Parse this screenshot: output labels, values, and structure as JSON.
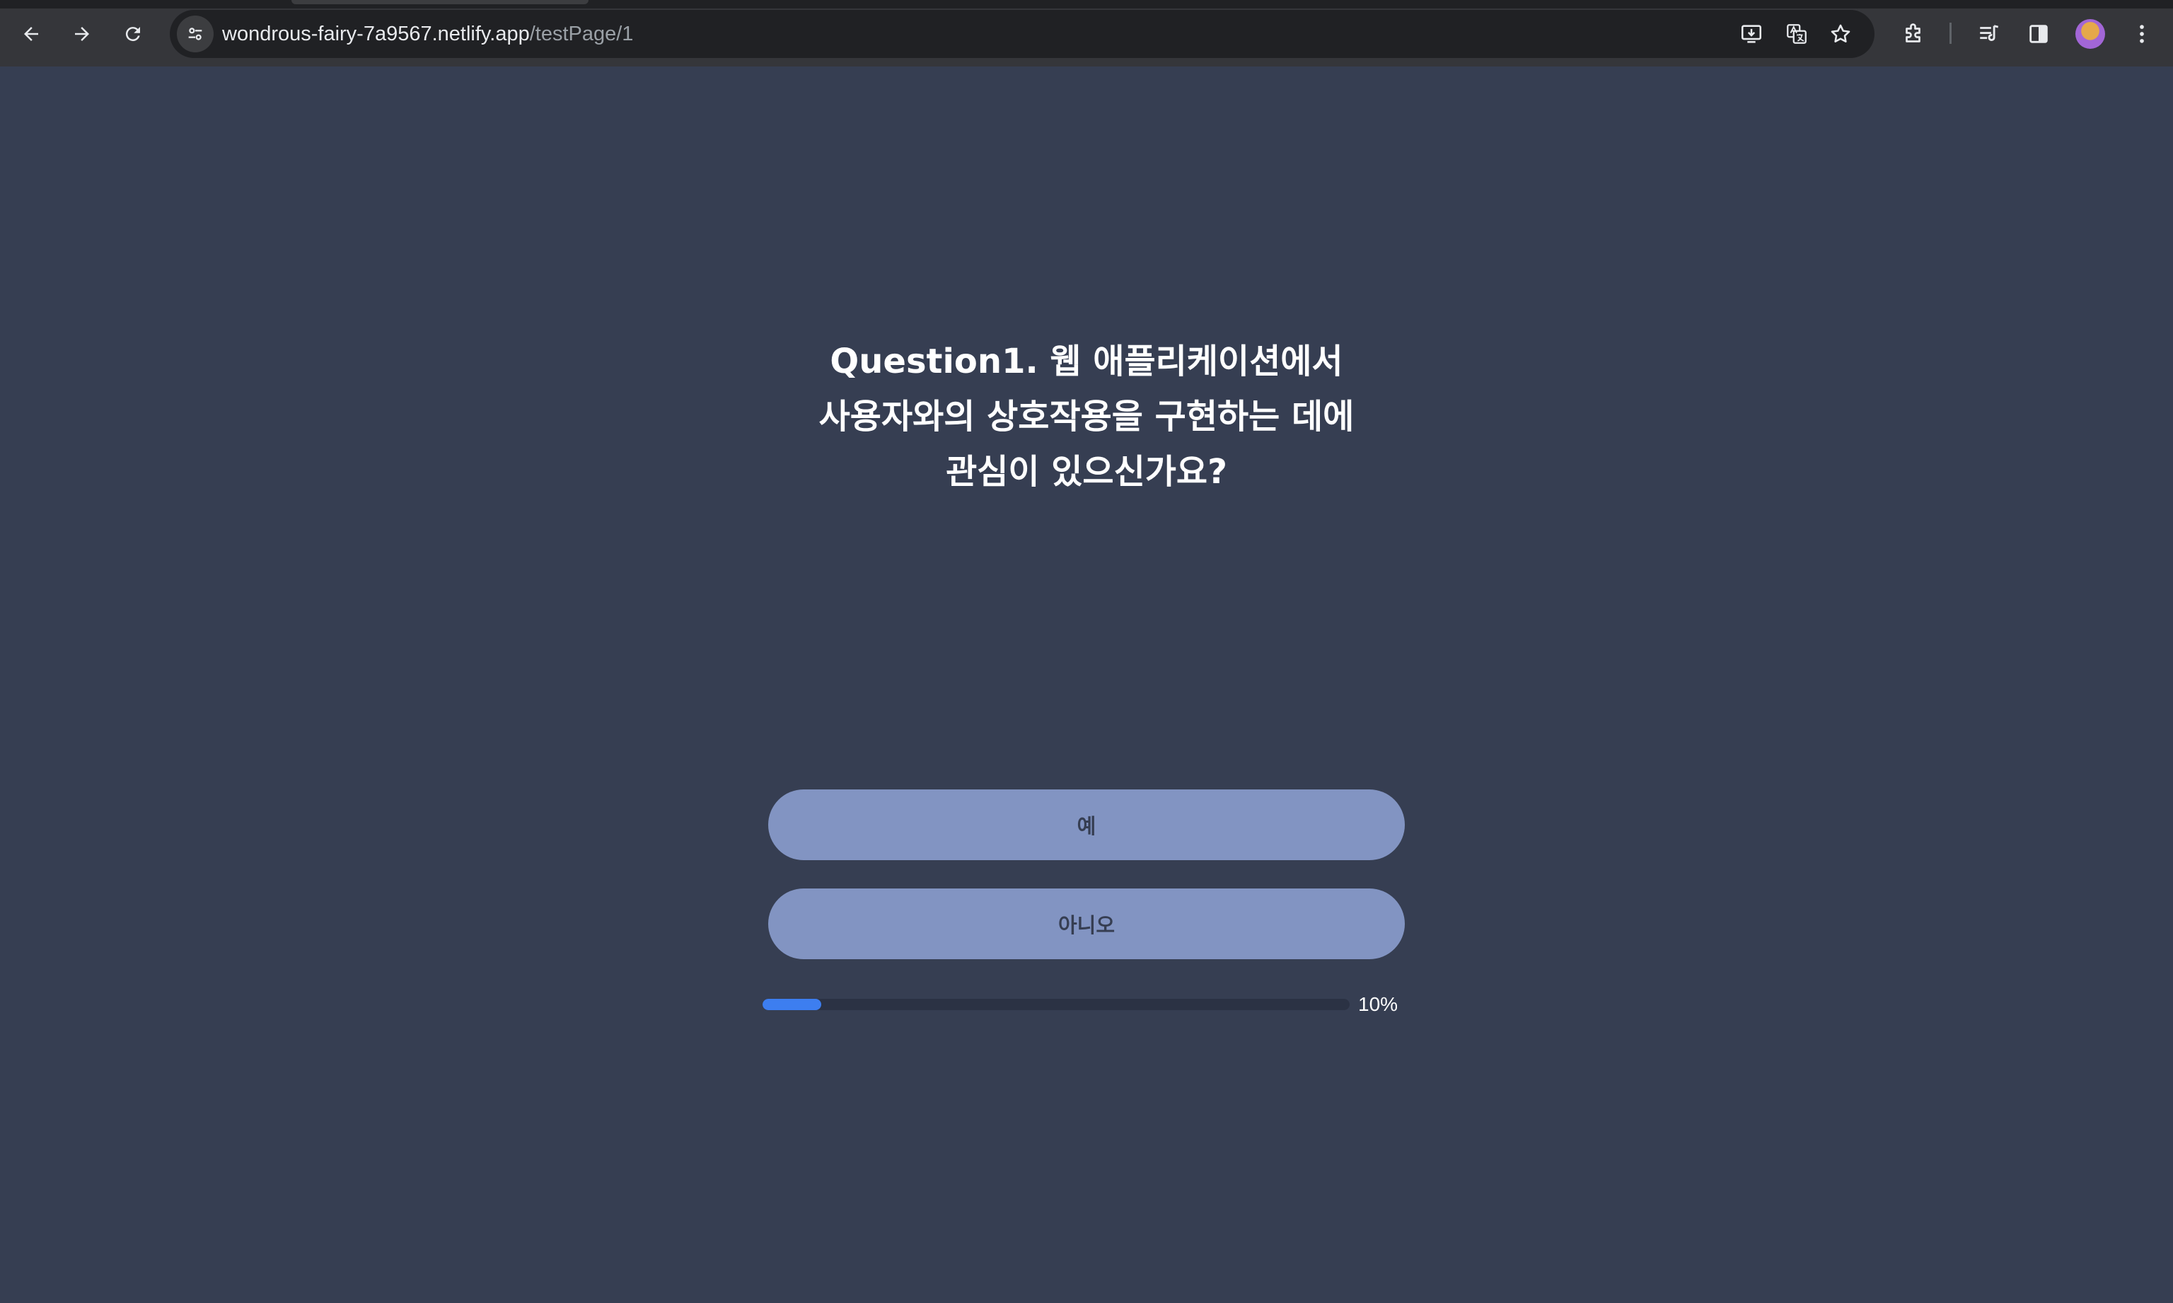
{
  "browser": {
    "url_host": "wondrous-fairy-7a9567.netlify.app",
    "url_path": "/testPage/1",
    "icons": {
      "back": "arrow-left-icon",
      "forward": "arrow-right-icon",
      "reload": "reload-icon",
      "site_info": "tune-icon",
      "install": "install-app-icon",
      "translate": "translate-icon",
      "bookmark": "star-icon",
      "extensions": "puzzle-icon",
      "media": "media-control-icon",
      "side_panel": "side-panel-icon",
      "menu": "more-vertical-icon"
    }
  },
  "quiz": {
    "question": "Question1. 웹 애플리케이션에서\n사용자와의 상호작용을 구현하는 데에\n관심이 있으신가요?",
    "answers": [
      "예",
      "아니오"
    ],
    "progress_fraction": 0.1,
    "progress_label": "10%"
  },
  "colors": {
    "page_bg": "#363e52",
    "button_bg": "#8294c2",
    "progress_fill": "#3d7ef0",
    "progress_track": "#2b3244"
  }
}
